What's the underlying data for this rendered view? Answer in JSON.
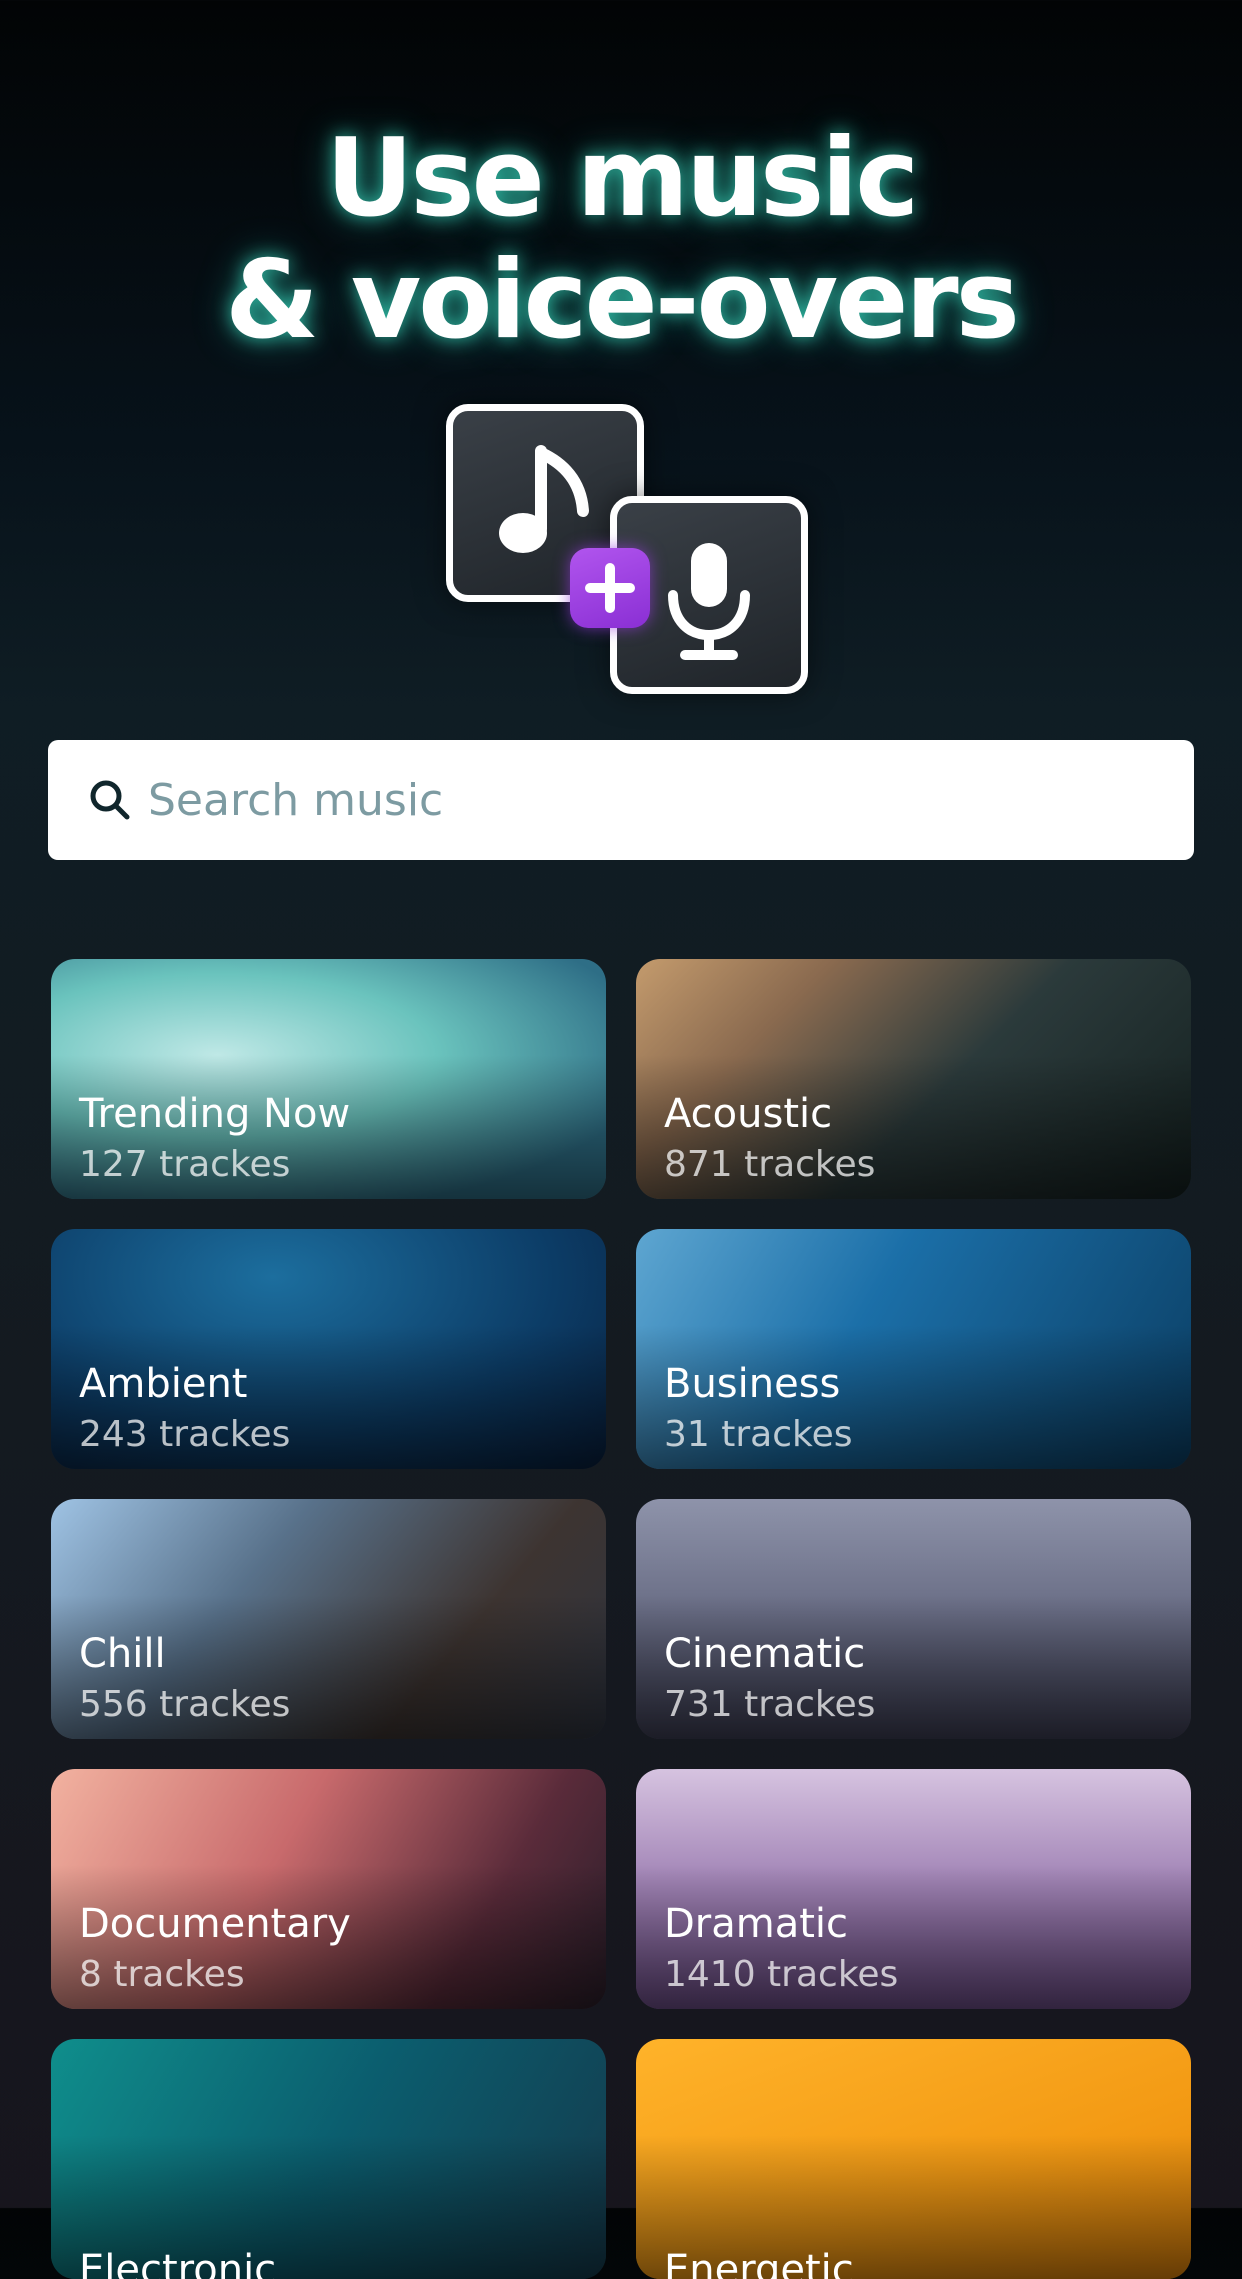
{
  "header": {
    "title_line1": "Use music",
    "title_line2": "& voice-overs"
  },
  "icons": {
    "music": "music-note-icon",
    "plus": "plus-icon",
    "mic": "microphone-icon",
    "search": "search-icon"
  },
  "search": {
    "placeholder": "Search music"
  },
  "categories": [
    {
      "title": "Trending Now",
      "count": "127 trackes"
    },
    {
      "title": "Acoustic",
      "count": "871 trackes"
    },
    {
      "title": "Ambient",
      "count": "243 trackes"
    },
    {
      "title": "Business",
      "count": "31 trackes"
    },
    {
      "title": "Chill",
      "count": "556 trackes"
    },
    {
      "title": "Cinematic",
      "count": "731 trackes"
    },
    {
      "title": "Documentary",
      "count": "8 trackes"
    },
    {
      "title": "Dramatic",
      "count": "1410 trackes"
    },
    {
      "title": "Electronic",
      "count": ""
    },
    {
      "title": "Energetic",
      "count": ""
    }
  ],
  "colors": {
    "glow": "#3ce6c8",
    "accent_purple": "#a544e6",
    "search_placeholder": "#7d9ba2"
  }
}
